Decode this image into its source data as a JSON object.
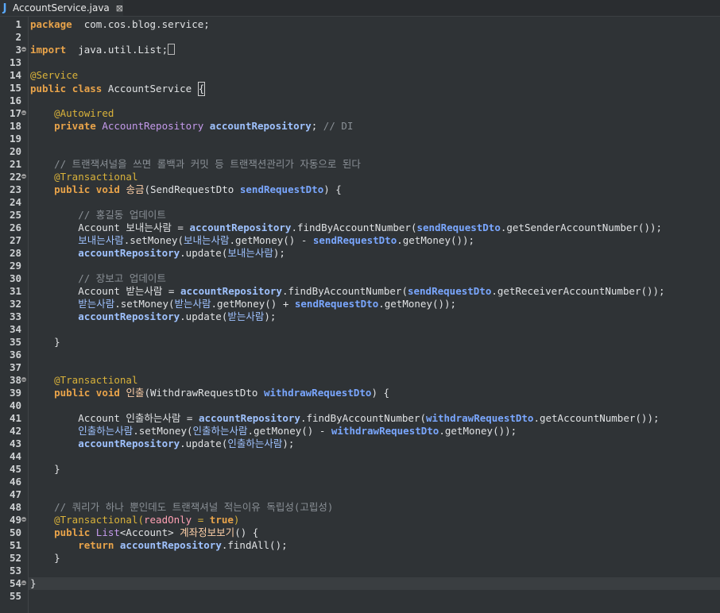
{
  "tab": {
    "title": "AccountService.java",
    "icon": "java-file-icon",
    "close": "⊠"
  },
  "lines": [
    {
      "n": "1",
      "fold": false,
      "t": [
        [
          "kw",
          "package"
        ],
        [
          "",
          "  com.cos.blog.service;"
        ]
      ]
    },
    {
      "n": "2",
      "fold": false,
      "t": []
    },
    {
      "n": "3",
      "fold": true,
      "t": [
        [
          "kw",
          "import"
        ],
        [
          "",
          "  java.util.List;"
        ],
        [
          "box",
          ""
        ]
      ]
    },
    {
      "n": "13",
      "fold": false,
      "t": []
    },
    {
      "n": "14",
      "fold": false,
      "t": [
        [
          "ann",
          "@Service"
        ]
      ]
    },
    {
      "n": "15",
      "fold": false,
      "t": [
        [
          "kw",
          "public"
        ],
        [
          "",
          " "
        ],
        [
          "kw",
          "class"
        ],
        [
          "",
          " AccountService "
        ],
        [
          "cur",
          "{"
        ]
      ]
    },
    {
      "n": "16",
      "fold": false,
      "t": []
    },
    {
      "n": "17",
      "fold": true,
      "t": [
        [
          "",
          "    "
        ],
        [
          "ann",
          "@Autowired"
        ]
      ]
    },
    {
      "n": "18",
      "fold": false,
      "t": [
        [
          "",
          "    "
        ],
        [
          "kw",
          "private"
        ],
        [
          "",
          " "
        ],
        [
          "ty",
          "AccountRepository"
        ],
        [
          "",
          " "
        ],
        [
          "fld",
          "accountRepository"
        ],
        [
          "",
          "; "
        ],
        [
          "cm",
          "// DI"
        ]
      ]
    },
    {
      "n": "19",
      "fold": false,
      "t": []
    },
    {
      "n": "20",
      "fold": false,
      "t": []
    },
    {
      "n": "21",
      "fold": false,
      "t": [
        [
          "",
          "    "
        ],
        [
          "cm",
          "// 트랜잭셔널을 쓰면 롤백과 커밋 등 트랜잭션관리가 자동으로 된다"
        ]
      ]
    },
    {
      "n": "22",
      "fold": true,
      "t": [
        [
          "",
          "    "
        ],
        [
          "ann",
          "@Transactional"
        ]
      ]
    },
    {
      "n": "23",
      "fold": false,
      "t": [
        [
          "",
          "    "
        ],
        [
          "kw",
          "public"
        ],
        [
          "",
          " "
        ],
        [
          "kw",
          "void"
        ],
        [
          "",
          " "
        ],
        [
          "met",
          "송금"
        ],
        [
          "",
          "(SendRequestDto "
        ],
        [
          "par",
          "sendRequestDto"
        ],
        [
          "",
          ") {"
        ]
      ]
    },
    {
      "n": "24",
      "fold": false,
      "t": []
    },
    {
      "n": "25",
      "fold": false,
      "t": [
        [
          "",
          "        "
        ],
        [
          "cm",
          "// 홍길동 업데이트"
        ]
      ]
    },
    {
      "n": "26",
      "fold": false,
      "t": [
        [
          "",
          "        Account 보내는사람 = "
        ],
        [
          "fld",
          "accountRepository"
        ],
        [
          "",
          ".findByAccountNumber("
        ],
        [
          "par",
          "sendRequestDto"
        ],
        [
          "",
          ".getSenderAccountNumber());"
        ]
      ]
    },
    {
      "n": "27",
      "fold": false,
      "t": [
        [
          "",
          "        "
        ],
        [
          "var",
          "보내는사람"
        ],
        [
          "",
          ".setMoney("
        ],
        [
          "var",
          "보내는사람"
        ],
        [
          "",
          ".getMoney() - "
        ],
        [
          "par",
          "sendRequestDto"
        ],
        [
          "",
          ".getMoney());"
        ]
      ]
    },
    {
      "n": "28",
      "fold": false,
      "t": [
        [
          "",
          "        "
        ],
        [
          "fld",
          "accountRepository"
        ],
        [
          "",
          ".update("
        ],
        [
          "var",
          "보내는사람"
        ],
        [
          "",
          ");"
        ]
      ]
    },
    {
      "n": "29",
      "fold": false,
      "t": []
    },
    {
      "n": "30",
      "fold": false,
      "t": [
        [
          "",
          "        "
        ],
        [
          "cm",
          "// 장보고 업데이트"
        ]
      ]
    },
    {
      "n": "31",
      "fold": false,
      "t": [
        [
          "",
          "        Account 받는사람 = "
        ],
        [
          "fld",
          "accountRepository"
        ],
        [
          "",
          ".findByAccountNumber("
        ],
        [
          "par",
          "sendRequestDto"
        ],
        [
          "",
          ".getReceiverAccountNumber());"
        ]
      ]
    },
    {
      "n": "32",
      "fold": false,
      "t": [
        [
          "",
          "        "
        ],
        [
          "var",
          "받는사람"
        ],
        [
          "",
          ".setMoney("
        ],
        [
          "var",
          "받는사람"
        ],
        [
          "",
          ".getMoney() + "
        ],
        [
          "par",
          "sendRequestDto"
        ],
        [
          "",
          ".getMoney());"
        ]
      ]
    },
    {
      "n": "33",
      "fold": false,
      "t": [
        [
          "",
          "        "
        ],
        [
          "fld",
          "accountRepository"
        ],
        [
          "",
          ".update("
        ],
        [
          "var",
          "받는사람"
        ],
        [
          "",
          ");"
        ]
      ]
    },
    {
      "n": "34",
      "fold": false,
      "t": []
    },
    {
      "n": "35",
      "fold": false,
      "t": [
        [
          "",
          "    }"
        ]
      ]
    },
    {
      "n": "36",
      "fold": false,
      "t": []
    },
    {
      "n": "37",
      "fold": false,
      "t": []
    },
    {
      "n": "38",
      "fold": true,
      "t": [
        [
          "",
          "    "
        ],
        [
          "ann",
          "@Transactional"
        ]
      ]
    },
    {
      "n": "39",
      "fold": false,
      "t": [
        [
          "",
          "    "
        ],
        [
          "kw",
          "public"
        ],
        [
          "",
          " "
        ],
        [
          "kw",
          "void"
        ],
        [
          "",
          " "
        ],
        [
          "met",
          "인출"
        ],
        [
          "",
          "(WithdrawRequestDto "
        ],
        [
          "par",
          "withdrawRequestDto"
        ],
        [
          "",
          ") {"
        ]
      ]
    },
    {
      "n": "40",
      "fold": false,
      "t": []
    },
    {
      "n": "41",
      "fold": false,
      "t": [
        [
          "",
          "        Account 인출하는사람 = "
        ],
        [
          "fld",
          "accountRepository"
        ],
        [
          "",
          ".findByAccountNumber("
        ],
        [
          "par",
          "withdrawRequestDto"
        ],
        [
          "",
          ".getAccountNumber());"
        ]
      ]
    },
    {
      "n": "42",
      "fold": false,
      "t": [
        [
          "",
          "        "
        ],
        [
          "var",
          "인출하는사람"
        ],
        [
          "",
          ".setMoney("
        ],
        [
          "var",
          "인출하는사람"
        ],
        [
          "",
          ".getMoney() - "
        ],
        [
          "par",
          "withdrawRequestDto"
        ],
        [
          "",
          ".getMoney());"
        ]
      ]
    },
    {
      "n": "43",
      "fold": false,
      "t": [
        [
          "",
          "        "
        ],
        [
          "fld",
          "accountRepository"
        ],
        [
          "",
          ".update("
        ],
        [
          "var",
          "인출하는사람"
        ],
        [
          "",
          ");"
        ]
      ]
    },
    {
      "n": "44",
      "fold": false,
      "t": []
    },
    {
      "n": "45",
      "fold": false,
      "t": [
        [
          "",
          "    }"
        ]
      ]
    },
    {
      "n": "46",
      "fold": false,
      "t": []
    },
    {
      "n": "47",
      "fold": false,
      "t": []
    },
    {
      "n": "48",
      "fold": false,
      "t": [
        [
          "",
          "    "
        ],
        [
          "cm",
          "// 쿼리가 하나 뿐인데도 트랜잭셔널 적는이유 독립성(고립성)"
        ]
      ]
    },
    {
      "n": "49",
      "fold": true,
      "t": [
        [
          "",
          "    "
        ],
        [
          "ann",
          "@Transactional("
        ],
        [
          "str",
          "readOnly"
        ],
        [
          "ann",
          " = "
        ],
        [
          "kw",
          "true"
        ],
        [
          "ann",
          ")"
        ]
      ]
    },
    {
      "n": "50",
      "fold": false,
      "t": [
        [
          "",
          "    "
        ],
        [
          "kw",
          "public"
        ],
        [
          "",
          " "
        ],
        [
          "ty",
          "List"
        ],
        [
          "",
          "<Account> "
        ],
        [
          "met",
          "계좌정보보기"
        ],
        [
          "",
          "() {"
        ]
      ]
    },
    {
      "n": "51",
      "fold": false,
      "t": [
        [
          "",
          "        "
        ],
        [
          "kw",
          "return"
        ],
        [
          "",
          " "
        ],
        [
          "fld",
          "accountRepository"
        ],
        [
          "",
          ".findAll();"
        ]
      ]
    },
    {
      "n": "52",
      "fold": false,
      "t": [
        [
          "",
          "    }"
        ]
      ]
    },
    {
      "n": "53",
      "fold": false,
      "t": []
    },
    {
      "n": "54",
      "fold": true,
      "t": [
        [
          "",
          "}"
        ]
      ]
    },
    {
      "n": "55",
      "fold": false,
      "t": []
    }
  ],
  "highlight_line": "54"
}
